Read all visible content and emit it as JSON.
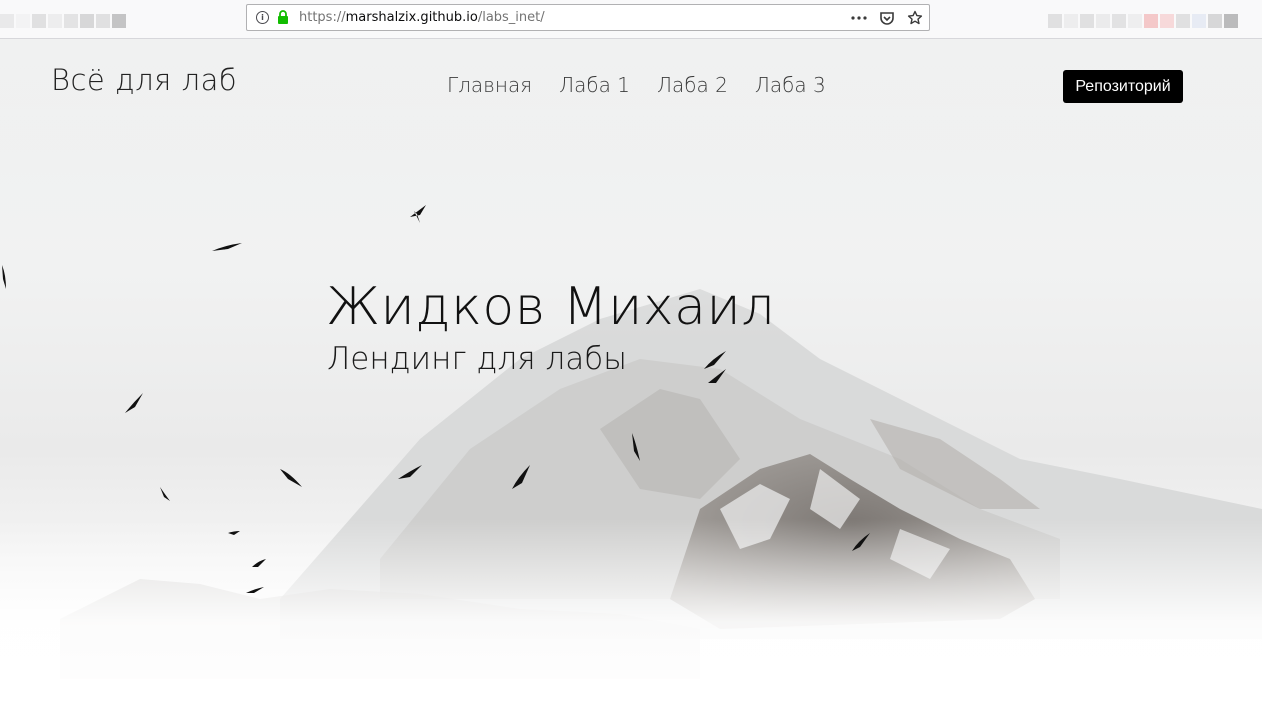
{
  "browser": {
    "url_scheme": "https://",
    "url_host": "marshalzix.github.io",
    "url_path": "/labs_inet/",
    "icons": [
      "info-icon",
      "lock-icon",
      "more-icon",
      "pocket-icon",
      "bookmark-star-icon"
    ]
  },
  "site": {
    "brand": "Всё для лаб",
    "nav": [
      "Главная",
      "Лаба 1",
      "Лаба 2",
      "Лаба 3"
    ],
    "repo_button": "Репозиторий"
  },
  "hero": {
    "title": "Жидков Михаил",
    "subtitle": "Лендинг для лабы"
  },
  "colors": {
    "button_bg": "#000000",
    "button_text": "#ffffff",
    "lock_green": "#12bc00"
  }
}
